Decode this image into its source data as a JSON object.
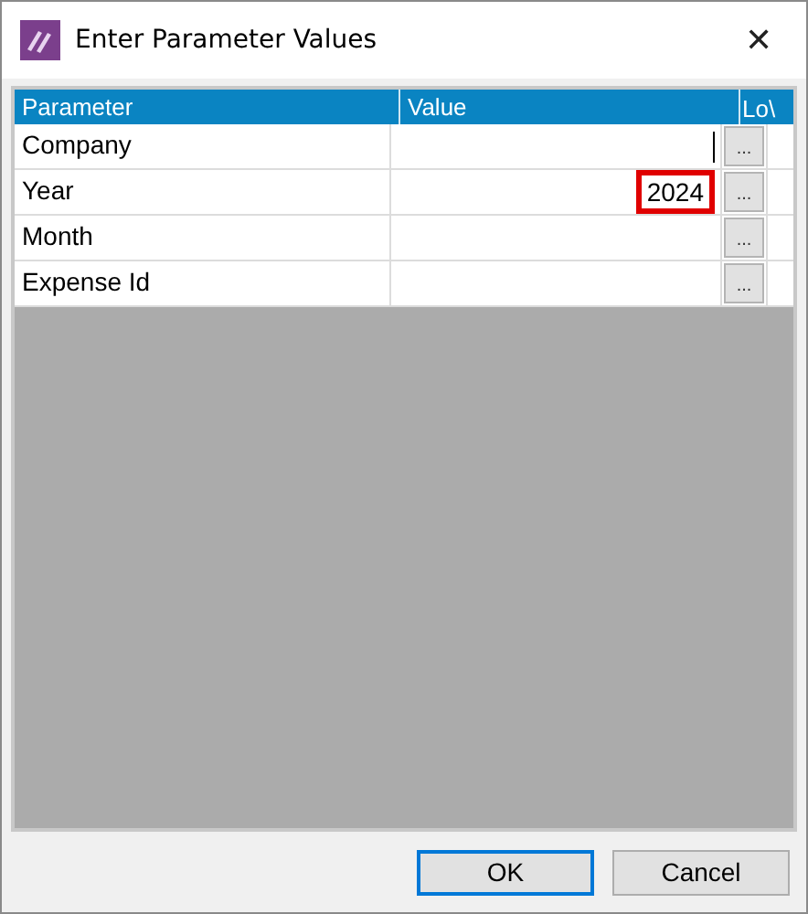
{
  "window": {
    "title": "Enter Parameter Values",
    "close": "✕"
  },
  "table": {
    "columns": [
      "Parameter",
      "Value",
      "Lo\\"
    ],
    "rows": [
      {
        "parameter": "Company",
        "cursor": true,
        "highlighted": false,
        "lov": "..."
      },
      {
        "parameter": "Year",
        "value": "2024",
        "cursor": false,
        "highlighted": true,
        "lov": "..."
      },
      {
        "parameter": "Month",
        "cursor": false,
        "highlighted": false,
        "lov": "..."
      },
      {
        "parameter": "Expense Id",
        "cursor": false,
        "highlighted": false,
        "lov": "..."
      }
    ]
  },
  "buttons": [
    {
      "label": "OK",
      "default": true
    },
    {
      "label": "Cancel",
      "default": false
    }
  ]
}
